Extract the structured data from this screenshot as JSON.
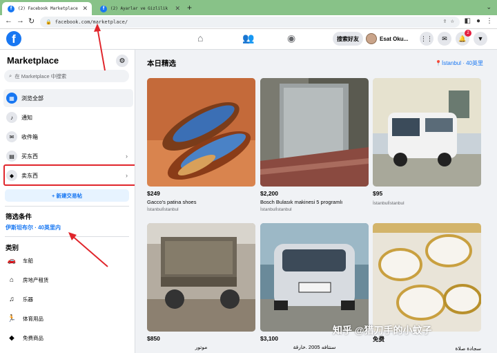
{
  "browser": {
    "tabs": [
      {
        "title": "(2) Facebook Marketplace | Fa",
        "active": true
      },
      {
        "title": "(2) Ayarlar ve Gizlilik | Fa",
        "active": false
      }
    ],
    "url": "facebook.com/marketplace/"
  },
  "fb_header": {
    "find_friends": "搜索好友",
    "user_name": "Esat Oku...",
    "notification_count": "2"
  },
  "sidebar": {
    "title": "Marketplace",
    "search_placeholder": "在 Marketplace 中搜索",
    "nav": [
      {
        "label": "浏览全部",
        "icon": "store-icon"
      },
      {
        "label": "通知",
        "icon": "bell-icon"
      },
      {
        "label": "收件箱",
        "icon": "inbox-icon"
      },
      {
        "label": "买东西",
        "icon": "shopping-bag-icon"
      },
      {
        "label": "卖东西",
        "icon": "tag-icon"
      }
    ],
    "new_listing": "+ 新建交易帖",
    "filters_title": "筛选条件",
    "location_filter": "伊斯坦布尔 · 40英里内",
    "categories_title": "类别",
    "categories": [
      {
        "label": "车船",
        "icon": "car-icon"
      },
      {
        "label": "房地产租赁",
        "icon": "house-icon"
      },
      {
        "label": "乐器",
        "icon": "guitar-icon"
      },
      {
        "label": "体育用品",
        "icon": "runner-icon"
      },
      {
        "label": "免费商品",
        "icon": "tag-icon"
      }
    ]
  },
  "main": {
    "title": "本日精选",
    "location": "İstanbul · 40英里",
    "listings": [
      {
        "price": "$249",
        "title": "Gacco's patina shoes",
        "location": "İstanbulİstanbul"
      },
      {
        "price": "$2,200",
        "title": "Bosch Bulasık makinesi 5 programlı",
        "location": "İstanbulİstanbul"
      },
      {
        "price": "$95",
        "title": "",
        "location": "İstanbulİstanbul"
      },
      {
        "price": "$850",
        "title": "موتور",
        "location": ""
      },
      {
        "price": "$3,100",
        "title": "سنتافه 2005 .خارقة",
        "location": ""
      },
      {
        "price": "免费",
        "title": "سجادة صلاة",
        "location": ""
      }
    ]
  },
  "watermark": "知乎 @猎刀手的小蚊子",
  "colors": {
    "fb_blue": "#1877f2",
    "highlight_red": "#e0252b",
    "tab_green": "#88c288"
  }
}
